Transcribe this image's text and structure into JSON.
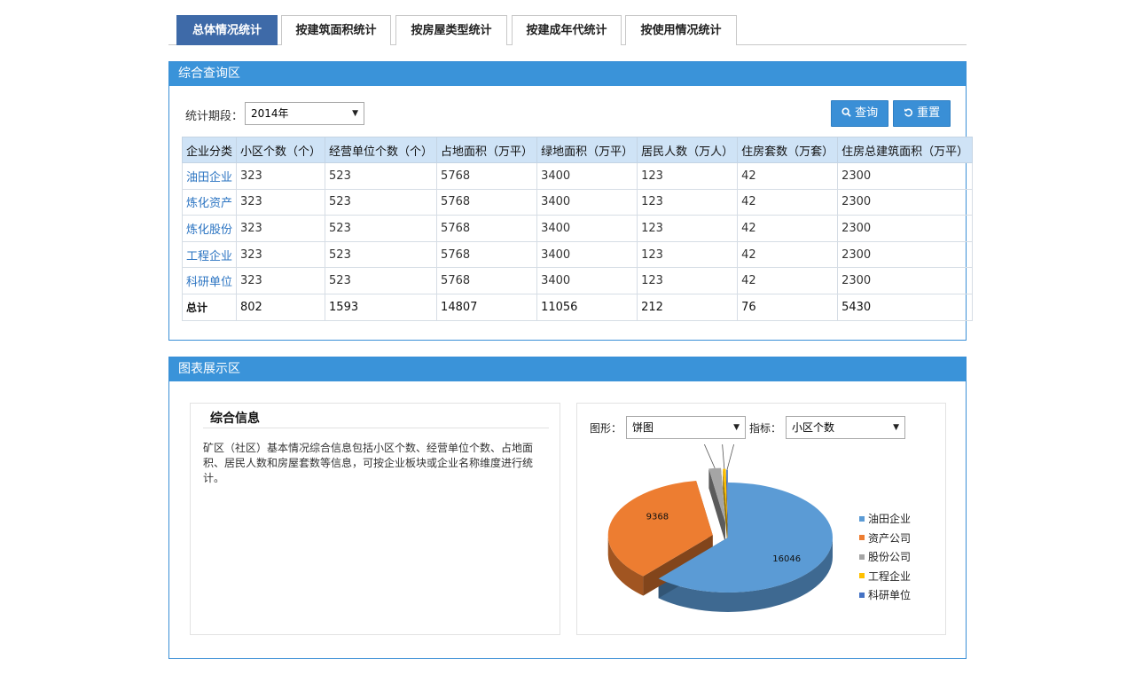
{
  "tabs": [
    {
      "label": "总体情况统计",
      "active": true
    },
    {
      "label": "按建筑面积统计",
      "active": false
    },
    {
      "label": "按房屋类型统计",
      "active": false
    },
    {
      "label": "按建成年代统计",
      "active": false
    },
    {
      "label": "按使用情况统计",
      "active": false
    }
  ],
  "query_panel": {
    "title": "综合查询区",
    "period_label": "统计期段：",
    "period_value": "2014年",
    "search_button": "查询",
    "reset_button": "重置",
    "search_icon": "search-icon",
    "reset_icon": "undo-icon"
  },
  "table": {
    "headers": [
      "企业分类",
      "小区个数（个）",
      "经营单位个数（个）",
      "占地面积（万平）",
      "绿地面积（万平）",
      "居民人数（万人）",
      "住房套数（万套）",
      "住房总建筑面积（万平）"
    ],
    "rows": [
      [
        "油田企业",
        "323",
        "523",
        "5768",
        "3400",
        "123",
        "42",
        "2300"
      ],
      [
        "炼化资产",
        "323",
        "523",
        "5768",
        "3400",
        "123",
        "42",
        "2300"
      ],
      [
        "炼化股份",
        "323",
        "523",
        "5768",
        "3400",
        "123",
        "42",
        "2300"
      ],
      [
        "工程企业",
        "323",
        "523",
        "5768",
        "3400",
        "123",
        "42",
        "2300"
      ],
      [
        "科研单位",
        "323",
        "523",
        "5768",
        "3400",
        "123",
        "42",
        "2300"
      ]
    ],
    "total": [
      "总计",
      "802",
      "1593",
      "14807",
      "11056",
      "212",
      "76",
      "5430"
    ]
  },
  "chart_panel": {
    "title": "图表展示区",
    "info_title": "综合信息",
    "info_text": "矿区（社区）基本情况综合信息包括小区个数、经营单位个数、占地面积、居民人数和房屋套数等信息，可按企业板块或企业名称维度进行统计。",
    "shape_label": "图形：",
    "shape_value": "饼图",
    "metric_label": "指标：",
    "metric_value": "小区个数"
  },
  "chart_data": {
    "type": "pie",
    "title": "",
    "categories": [
      "油田企业",
      "资产公司",
      "股份公司",
      "工程企业",
      "科研单位"
    ],
    "values": [
      16046,
      9368,
      481,
      116,
      60
    ],
    "colors": [
      "#5b9bd5",
      "#ed7d31",
      "#a5a5a5",
      "#ffc000",
      "#4472c4"
    ],
    "legend_position": "right",
    "exploded": true,
    "style": "3d"
  }
}
